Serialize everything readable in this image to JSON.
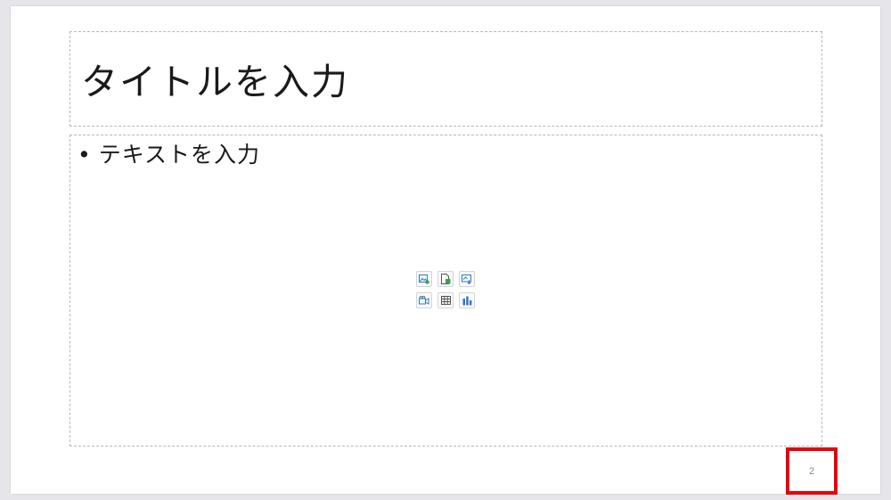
{
  "slide": {
    "title_placeholder": "タイトルを入力",
    "body_bullet": "•",
    "body_placeholder": "テキストを入力",
    "page_number": "2"
  },
  "insert_icons": [
    {
      "name": "insert-picture-icon"
    },
    {
      "name": "insert-file-icon"
    },
    {
      "name": "insert-online-picture-icon"
    },
    {
      "name": "insert-video-icon"
    },
    {
      "name": "insert-table-icon"
    },
    {
      "name": "insert-chart-icon"
    }
  ],
  "colors": {
    "accent_blue": "#2f78c8",
    "accent_green": "#3aa14b",
    "highlight_red": "#e8000b"
  }
}
